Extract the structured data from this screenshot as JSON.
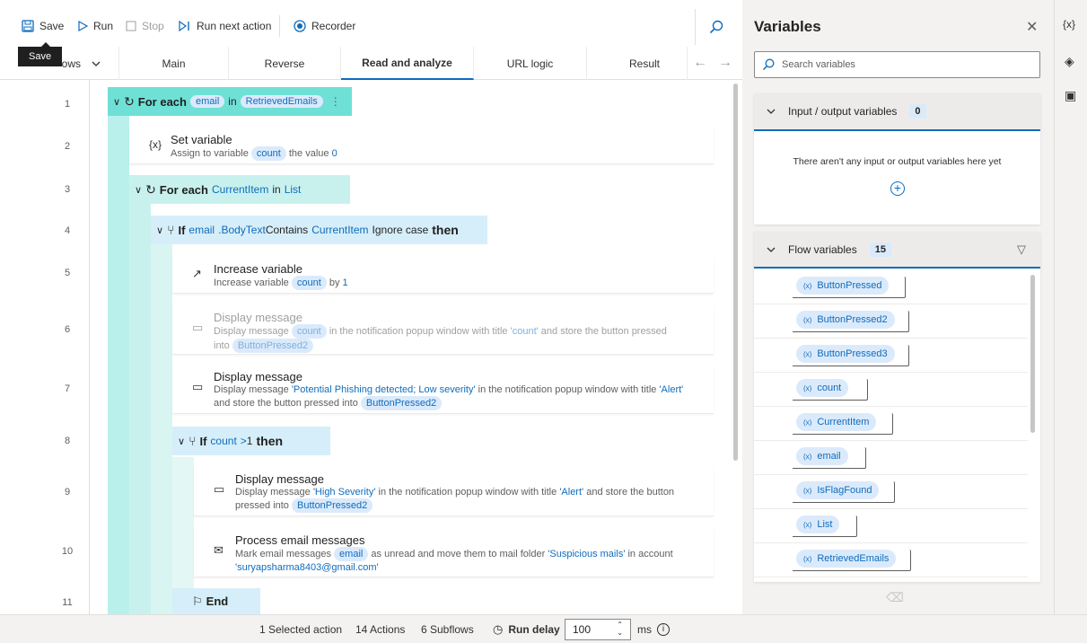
{
  "toolbar": {
    "save": "Save",
    "run": "Run",
    "stop": "Stop",
    "run_next": "Run next action",
    "recorder": "Recorder",
    "tooltip": "Save"
  },
  "tabs": {
    "subflows": "ows",
    "items": [
      "Main",
      "Reverse",
      "Read and analyze",
      "URL logic",
      "Result"
    ],
    "active": "Read and analyze"
  },
  "lines": [
    "1",
    "2",
    "3",
    "4",
    "5",
    "6",
    "7",
    "8",
    "9",
    "10",
    "11"
  ],
  "actions": {
    "foreach1": {
      "kw": "For each",
      "var": "email",
      "in": "in",
      "list": "RetrievedEmails"
    },
    "setvar": {
      "title": "Set variable",
      "d1": "Assign to variable",
      "var": "count",
      "d2": "the value",
      "val": "0",
      "icon": "{x}"
    },
    "foreach2": {
      "kw": "For each",
      "var": "CurrentItem",
      "in": "in",
      "list": "List"
    },
    "if1": {
      "kw": "If",
      "var": "email",
      "prop": ".BodyText",
      "op": "Contains",
      "var2": "CurrentItem",
      "opt": "Ignore case",
      "then": "then"
    },
    "inc": {
      "title": "Increase variable",
      "d1": "Increase variable",
      "var": "count",
      "d2": "by",
      "val": "1"
    },
    "msg1": {
      "title": "Display message",
      "d1": "Display message",
      "var": "count",
      "d2": "in the notification popup window with title",
      "t": "'count'",
      "d3": "and store the button pressed",
      "d4": "into",
      "var2": "ButtonPressed2"
    },
    "msg2": {
      "title": "Display message",
      "d1": "Display message",
      "m": "'Potential Phishing detected; Low severity'",
      "d2": "in the notification popup window with title",
      "t": "'Alert'",
      "d3": "and store the button pressed into",
      "var2": "ButtonPressed2"
    },
    "if2": {
      "kw": "If",
      "var": "count",
      "op": ">",
      "val": "1",
      "then": "then"
    },
    "msg3": {
      "title": "Display message",
      "d1": "Display message",
      "m": "'High Severity'",
      "d2": "in the notification popup window with title",
      "t": "'Alert'",
      "d3": "and store the button",
      "d4": "pressed into",
      "var2": "ButtonPressed2"
    },
    "proc": {
      "title": "Process email messages",
      "d1": "Mark email messages",
      "var": "email",
      "d2": "as unread and move them to mail folder",
      "f": "'Suspicious mails'",
      "d3": "in account",
      "acct": "'suryapsharma8403@gmail.com'"
    },
    "end": {
      "kw": "End"
    }
  },
  "variables": {
    "title": "Variables",
    "search_placeholder": "Search variables",
    "io": {
      "label": "Input / output variables",
      "count": "0",
      "empty": "There aren't any input or output variables here yet"
    },
    "flow": {
      "label": "Flow variables",
      "count": "15",
      "items": [
        "ButtonPressed",
        "ButtonPressed2",
        "ButtonPressed3",
        "count",
        "CurrentItem",
        "email",
        "IsFlagFound",
        "List",
        "RetrievedEmails"
      ]
    },
    "chip_prefix": "(x)"
  },
  "rail": {
    "vars": "{x}"
  },
  "status": {
    "selected": "1 Selected action",
    "actions": "14 Actions",
    "subflows": "6 Subflows",
    "run_delay": "Run delay",
    "delay_value": "100",
    "unit": "ms"
  },
  "colors": {
    "accent": "#0f6cbd",
    "loop_header": "#6fe0d6",
    "block": "#c8f1ee"
  }
}
